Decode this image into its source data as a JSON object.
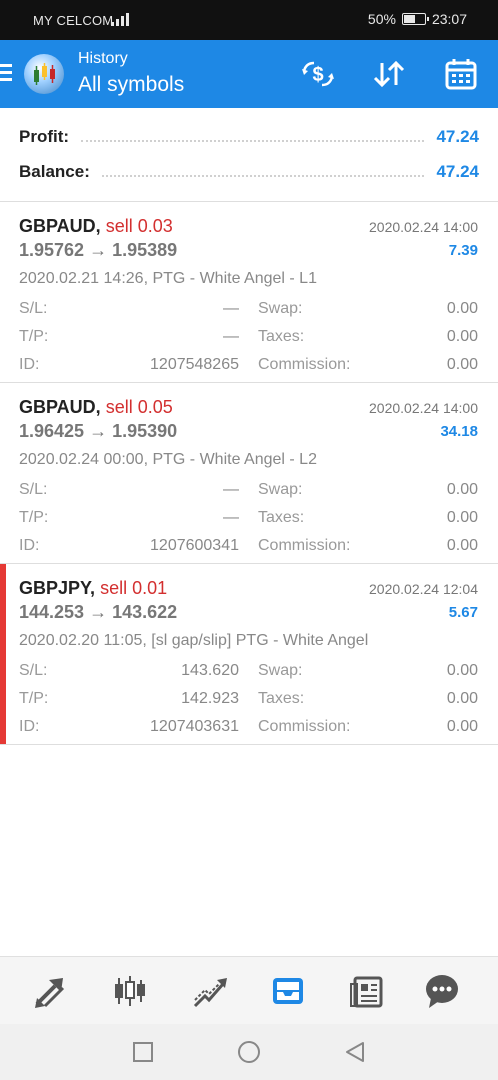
{
  "status": {
    "carrier": "MY CELCOM",
    "battery": "50%",
    "battery_level": 0.5,
    "time": "23:07"
  },
  "appbar": {
    "title": "History",
    "subtitle": "All symbols",
    "icons": [
      "menu-icon",
      "app-logo-icon",
      "currency-exchange-icon",
      "sort-icon",
      "calendar-icon"
    ]
  },
  "summary": {
    "profit_label": "Profit:",
    "profit_value": "47.24",
    "balance_label": "Balance:",
    "balance_value": "47.24"
  },
  "deals": [
    {
      "symbol": "GBPAUD,",
      "side": "sell 0.03",
      "time": "2020.02.24 14:00",
      "prices": "1.95762 → 1.95389",
      "profit": "7.39",
      "comment": "2020.02.21 14:26, PTG - White Angel - L1",
      "sl_label": "S/L:",
      "sl": "—",
      "tp_label": "T/P:",
      "tp": "—",
      "id_label": "ID:",
      "id": "1207548265",
      "swap_label": "Swap:",
      "swap": "0.00",
      "taxes_label": "Taxes:",
      "taxes": "0.00",
      "commission_label": "Commission:",
      "commission": "0.00"
    },
    {
      "symbol": "GBPAUD,",
      "side": "sell 0.05",
      "time": "2020.02.24 14:00",
      "prices": "1.96425 → 1.95390",
      "profit": "34.18",
      "comment": "2020.02.24 00:00, PTG - White Angel - L2",
      "sl_label": "S/L:",
      "sl": "—",
      "tp_label": "T/P:",
      "tp": "—",
      "id_label": "ID:",
      "id": "1207600341",
      "swap_label": "Swap:",
      "swap": "0.00",
      "taxes_label": "Taxes:",
      "taxes": "0.00",
      "commission_label": "Commission:",
      "commission": "0.00"
    },
    {
      "symbol": "GBPJPY,",
      "side": "sell 0.01",
      "time": "2020.02.24 12:04",
      "prices": "144.253 → 143.622",
      "profit": "5.67",
      "comment": "2020.02.20 11:05, [sl gap/slip] PTG - White Angel",
      "sl_label": "S/L:",
      "sl": "143.620",
      "tp_label": "T/P:",
      "tp": "142.923",
      "id_label": "ID:",
      "id": "1207403631",
      "swap_label": "Swap:",
      "swap": "0.00",
      "taxes_label": "Taxes:",
      "taxes": "0.00",
      "commission_label": "Commission:",
      "commission": "0.00",
      "marker_color": "#e53935"
    }
  ],
  "bottomnav": {
    "items": [
      "quotes-icon",
      "chart-icon",
      "trade-icon",
      "history-icon",
      "news-icon",
      "chat-icon"
    ],
    "active": "history-icon",
    "active_color": "#1e88e5",
    "inactive_color": "#555555"
  },
  "sysnav": [
    "recent-apps-icon",
    "home-icon",
    "back-icon"
  ]
}
